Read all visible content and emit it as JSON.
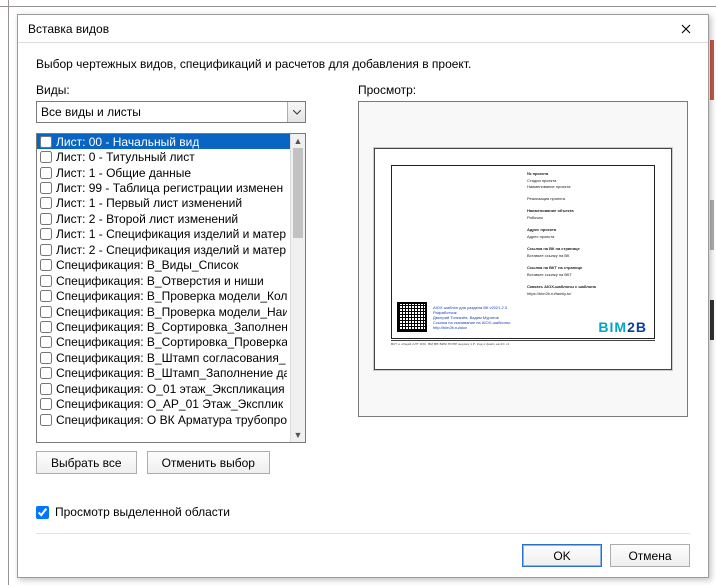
{
  "window": {
    "title": "Вставка видов"
  },
  "instruction": "Выбор чертежных видов, спецификаций и расчетов для добавления в проект.",
  "left": {
    "label": "Виды:",
    "dropdown_value": "Все виды и листы",
    "select_all": "Выбрать все",
    "deselect_all": "Отменить выбор"
  },
  "right": {
    "label": "Просмотр:"
  },
  "list": {
    "items": [
      "Лист: 00 - Начальный вид",
      "Лист: 0 - Титульный лист",
      "Лист: 1 - Общие данные",
      "Лист: 99 - Таблица регистрации изменен",
      "Лист: 1 - Первый лист изменений",
      "Лист: 2 - Второй лист изменений",
      "Лист: 1 - Спецификация изделий и матер",
      "Лист: 2 - Спецификация изделий и матер",
      "Спецификация: В_Виды_Список",
      "Спецификация: В_Отверстия и ниши",
      "Спецификация: В_Проверка модели_Кол",
      "Спецификация: В_Проверка модели_Наи",
      "Спецификация: В_Сортировка_Заполнен",
      "Спецификация: В_Сортировка_Проверка",
      "Спецификация: В_Штамп согласования_",
      "Спецификация: В_Штамп_Заполнение да",
      "Спецификация: О_01 этаж_Экспликация",
      "Спецификация: О_АР_01 Этаж_Эксплик",
      "Спецификация: О ВК Арматура трубопро"
    ]
  },
  "preview_checkbox": "Просмотр выделенной области",
  "footer": {
    "ok": "OK",
    "cancel": "Отмена"
  },
  "sheet": {
    "logo1": "BIM",
    "logo2": "2B",
    "line1": "AIOX шаблон для раздела ВК v2021.2.3",
    "line2": "Разработчик:",
    "line3": "Дмитрий Толкачёв, Вадим Муратов",
    "line4": "Ссылка на скачивание на AIOX-шаблоны:",
    "line5": "http://bim2b.ru/aiox"
  }
}
